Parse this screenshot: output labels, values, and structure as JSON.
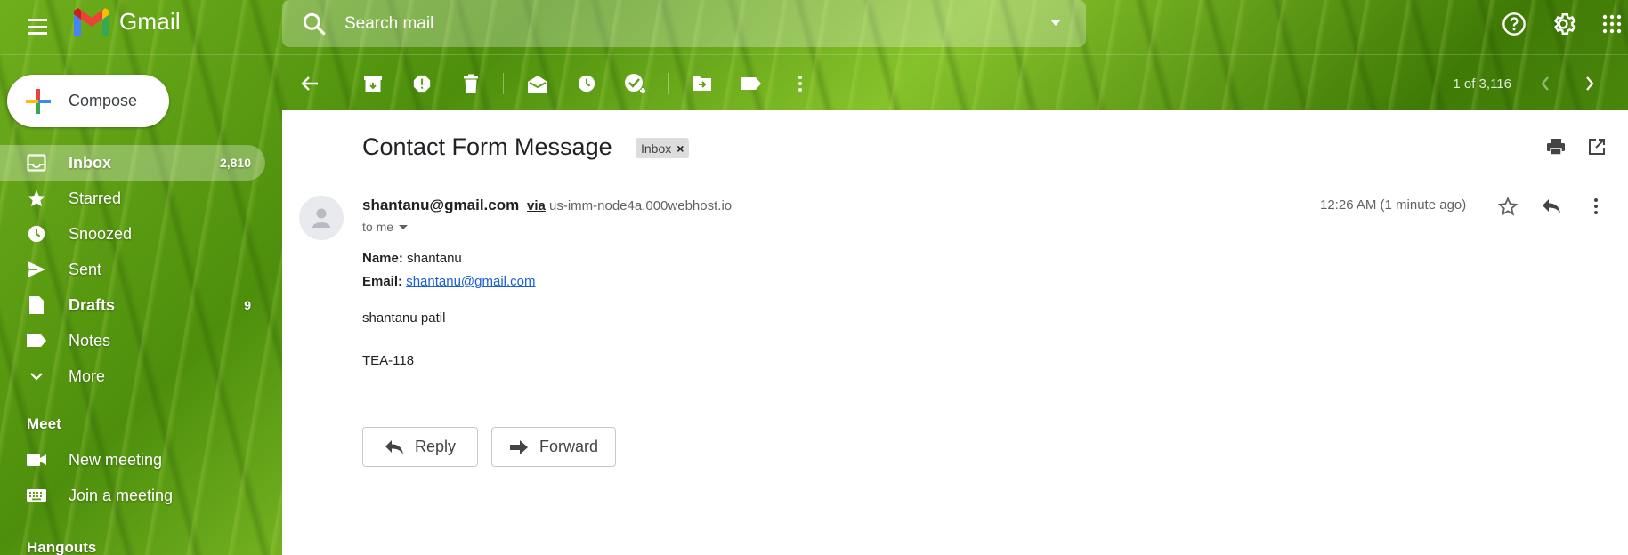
{
  "app": {
    "name": "Gmail"
  },
  "search": {
    "placeholder": "Search mail"
  },
  "compose": {
    "label": "Compose"
  },
  "sidebar": {
    "items": [
      {
        "label": "Inbox",
        "count": "2,810",
        "icon": "inbox-icon",
        "active": true,
        "bold": true
      },
      {
        "label": "Starred",
        "count": "",
        "icon": "star-icon"
      },
      {
        "label": "Snoozed",
        "count": "",
        "icon": "clock-icon"
      },
      {
        "label": "Sent",
        "count": "",
        "icon": "send-icon"
      },
      {
        "label": "Drafts",
        "count": "9",
        "icon": "draft-icon",
        "bold": true
      },
      {
        "label": "Notes",
        "count": "",
        "icon": "label-icon"
      },
      {
        "label": "More",
        "count": "",
        "icon": "chevron-down-icon"
      }
    ],
    "meet": {
      "title": "Meet",
      "items": [
        {
          "label": "New meeting",
          "icon": "video-icon"
        },
        {
          "label": "Join a meeting",
          "icon": "keyboard-icon"
        }
      ]
    },
    "hangouts": {
      "title": "Hangouts"
    }
  },
  "toolbar": {
    "pager": "1 of 3,116",
    "icons": [
      "back-arrow-icon",
      "archive-icon",
      "report-spam-icon",
      "delete-icon",
      "mark-unread-icon",
      "snooze-icon",
      "add-to-tasks-icon",
      "move-to-icon",
      "labels-icon",
      "more-vert-icon"
    ]
  },
  "message": {
    "subject": "Contact Form Message",
    "label_chip": "Inbox",
    "label_chip_close": "×",
    "sender": "shantanu@gmail.com",
    "via_label": "via",
    "via_host": "us-imm-node4a.000webhost.io",
    "to": "to me",
    "time": "12:26 AM (1 minute ago)",
    "name_label": "Name:",
    "name_value": "shantanu",
    "email_label": "Email:",
    "email_value": "shantanu@gmail.com",
    "body_line1": "shantanu patil",
    "body_line2": "TEA-118"
  },
  "actions": {
    "reply": "Reply",
    "forward": "Forward"
  },
  "colors": {
    "link": "#1a5fd6",
    "pane_bg": "#ffffff",
    "text": "#202124"
  }
}
